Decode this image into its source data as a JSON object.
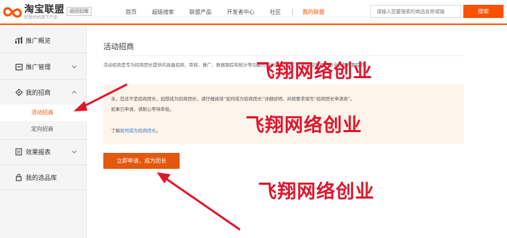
{
  "header": {
    "logo_title": "淘宝联盟",
    "logo_subtitle": "阿里妈妈旗下产品",
    "back_old": "返回旧版",
    "nav": [
      {
        "label": "首页"
      },
      {
        "label": "超级搜索"
      },
      {
        "label": "联盟产品"
      },
      {
        "label": "开发者中心"
      },
      {
        "label": "社区"
      }
    ],
    "nav_active": "我的联盟",
    "search_placeholder": "请输入您要搜索的商品名称或链",
    "search_button": "搜索"
  },
  "sidebar": {
    "items": [
      {
        "label": "推广概览",
        "icon": "chart-icon"
      },
      {
        "label": "推广管理",
        "icon": "wallet-icon"
      },
      {
        "label": "我的招商",
        "icon": "recruit-icon"
      },
      {
        "label": "效果报表",
        "icon": "report-icon"
      },
      {
        "label": "我的选品库",
        "icon": "lock-icon"
      }
    ],
    "sub_items": [
      {
        "label": "活动招商",
        "active": true
      },
      {
        "label": "定向招商",
        "active": false
      }
    ]
  },
  "main": {
    "title": "活动招商",
    "description": "活动招商是专为招商团长提供的具备招商、审核、推广、数据跟踪和统计等功能的活动管理平台，同时保证数据的安全性和可跟踪性。",
    "notice_line1": "亲，您还不是招商团长，如想成为招商团长，请仔细阅读“如何成为招商团长”详细说明，并按要求填写“招商团长申请表”。",
    "notice_line2": "如果已申请，请耐心等待审批。",
    "notice_line3_prefix": "了解",
    "notice_link": "如何成为招商团长",
    "notice_line3_suffix": "。",
    "apply_button": "立即申请，成为团长"
  },
  "watermark": "飞翔网络创业",
  "colors": {
    "accent": "#ff5000",
    "button": "#e4570c",
    "watermark": "#e0142b",
    "notice_bg": "#fdf4ea",
    "link": "#3b7bd4"
  }
}
